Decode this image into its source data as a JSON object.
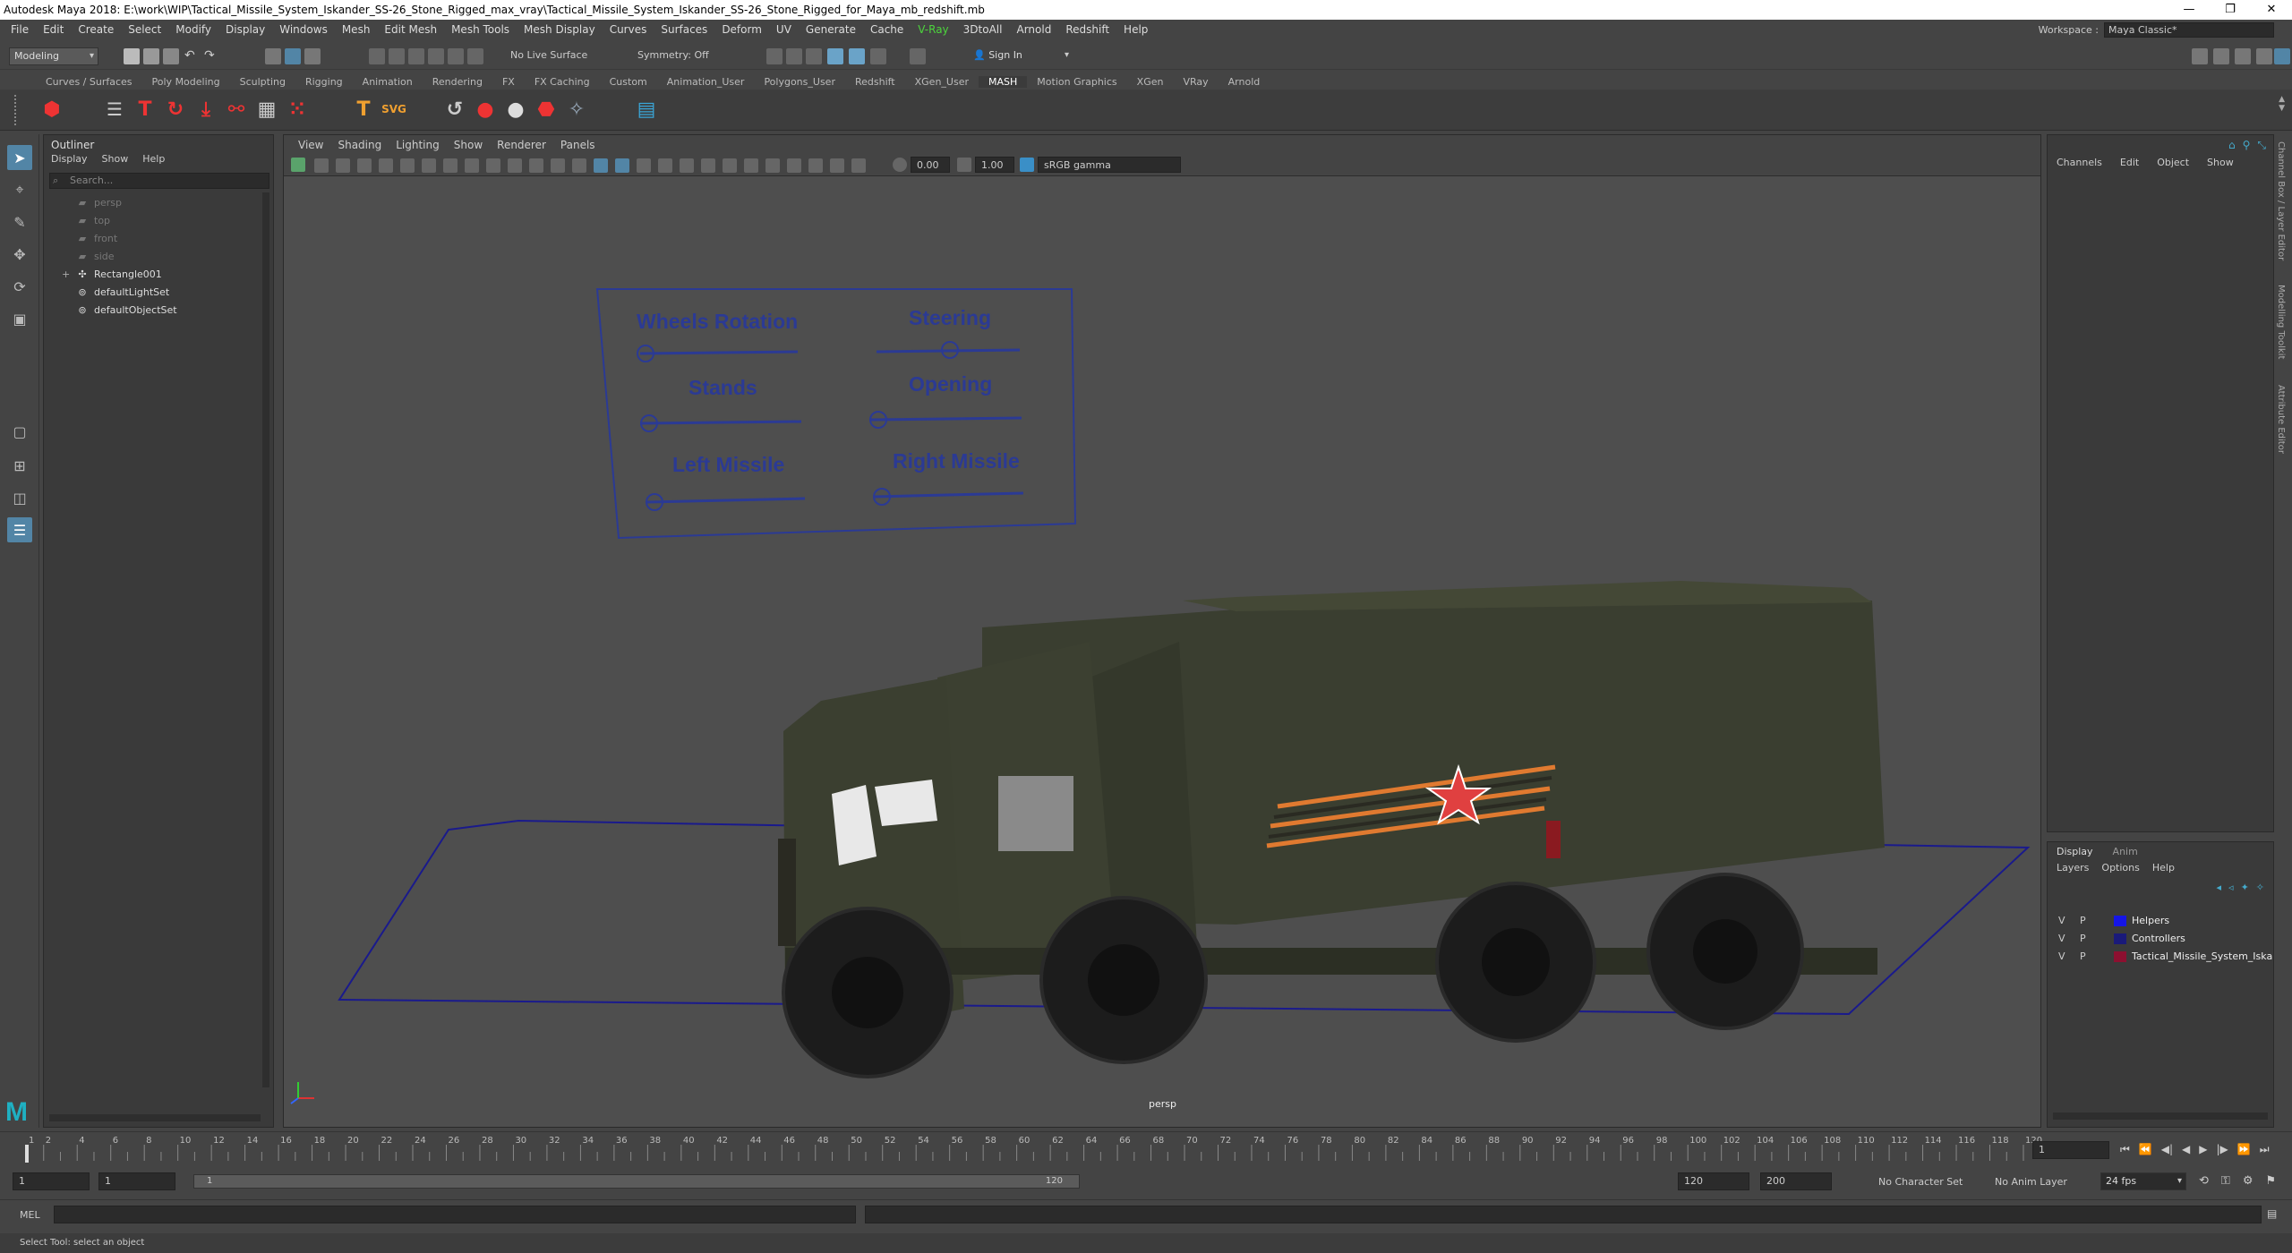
{
  "window": {
    "title": "Autodesk Maya 2018: E:\\work\\WIP\\Tactical_Missile_System_Iskander_SS-26_Stone_Rigged_max_vray\\Tactical_Missile_System_Iskander_SS-26_Stone_Rigged_for_Maya_mb_redshift.mb",
    "minimize": "—",
    "restore": "❐",
    "close": "✕"
  },
  "menu": [
    "File",
    "Edit",
    "Create",
    "Select",
    "Modify",
    "Display",
    "Windows",
    "Mesh",
    "Edit Mesh",
    "Mesh Tools",
    "Mesh Display",
    "Curves",
    "Surfaces",
    "Deform",
    "UV",
    "Generate",
    "Cache",
    "V-Ray",
    "3DtoAll",
    "Arnold",
    "Redshift",
    "Help"
  ],
  "workspace": {
    "label": "Workspace :",
    "value": "Maya Classic*"
  },
  "status": {
    "mode": "Modeling",
    "live_surface": "No Live Surface",
    "symmetry": "Symmetry: Off",
    "sign_in": "Sign In"
  },
  "shelf_tabs": [
    "Curves / Surfaces",
    "Poly Modeling",
    "Sculpting",
    "Rigging",
    "Animation",
    "Rendering",
    "FX",
    "FX Caching",
    "Custom",
    "Animation_User",
    "Polygons_User",
    "Redshift",
    "XGen_User",
    "MASH",
    "Motion Graphics",
    "XGen",
    "VRay",
    "Arnold"
  ],
  "shelf_active": "MASH",
  "outliner": {
    "title": "Outliner",
    "menu": [
      "Display",
      "Show",
      "Help"
    ],
    "search_placeholder": "Search...",
    "items": [
      {
        "label": "persp",
        "icon": "camera-icon",
        "dim": true
      },
      {
        "label": "top",
        "icon": "camera-icon",
        "dim": true
      },
      {
        "label": "front",
        "icon": "camera-icon",
        "dim": true
      },
      {
        "label": "side",
        "icon": "camera-icon",
        "dim": true
      },
      {
        "label": "Rectangle001",
        "icon": "transform-icon",
        "dim": false,
        "expand": "+"
      },
      {
        "label": "defaultLightSet",
        "icon": "set-icon",
        "dim": false
      },
      {
        "label": "defaultObjectSet",
        "icon": "set-icon",
        "dim": false
      }
    ]
  },
  "viewport": {
    "menu": [
      "View",
      "Shading",
      "Lighting",
      "Show",
      "Renderer",
      "Panels"
    ],
    "exposure": "0.00",
    "gamma": "1.00",
    "color_space": "sRGB gamma",
    "camera_label": "persp",
    "controls": {
      "wheels_rotation": "Wheels Rotation",
      "steering": "Steering",
      "stands": "Stands",
      "opening": "Opening",
      "left_missile": "Left Missile",
      "right_missile": "Right Missile"
    }
  },
  "channel_box": {
    "menu": [
      "Channels",
      "Edit",
      "Object",
      "Show"
    ],
    "side_tabs": [
      "Channel Box / Layer Editor",
      "Modelling Toolkit",
      "Attribute Editor"
    ]
  },
  "layer_editor": {
    "tabs": [
      "Display",
      "Anim"
    ],
    "menu": [
      "Layers",
      "Options",
      "Help"
    ],
    "layers": [
      {
        "v": "V",
        "p": "P",
        "name": "Helpers",
        "color": "#1515e6"
      },
      {
        "v": "V",
        "p": "P",
        "name": "Controllers",
        "color": "#1a1a7a"
      },
      {
        "v": "V",
        "p": "P",
        "name": "Tactical_Missile_System_Iskander_SSF",
        "color": "#8c1030"
      }
    ]
  },
  "timeline": {
    "ticks": [
      "1",
      "2",
      "4",
      "6",
      "8",
      "10",
      "12",
      "14",
      "16",
      "18",
      "20",
      "22",
      "24",
      "26",
      "28",
      "30",
      "32",
      "34",
      "36",
      "38",
      "40",
      "42",
      "44",
      "46",
      "48",
      "50",
      "52",
      "54",
      "56",
      "58",
      "60",
      "62",
      "64",
      "66",
      "68",
      "70",
      "72",
      "74",
      "76",
      "78",
      "80",
      "82",
      "84",
      "86",
      "88",
      "90",
      "92",
      "94",
      "96",
      "98",
      "100",
      "102",
      "104",
      "106",
      "108",
      "110",
      "112",
      "114",
      "116",
      "118",
      "120"
    ],
    "current_frame": "1"
  },
  "range": {
    "start": "1",
    "start_inner": "1",
    "range_start_label": "1",
    "range_end_label": "120",
    "end_inner": "120",
    "end": "200",
    "character_set": "No Character Set",
    "anim_layer": "No Anim Layer",
    "fps": "24 fps"
  },
  "command_line": {
    "label": "MEL"
  },
  "help_line": "Select Tool: select an object",
  "colors": {
    "selection": "#5285a6",
    "maya_logo": "#1fb0c2",
    "controller_blue": "#2b3a94"
  }
}
